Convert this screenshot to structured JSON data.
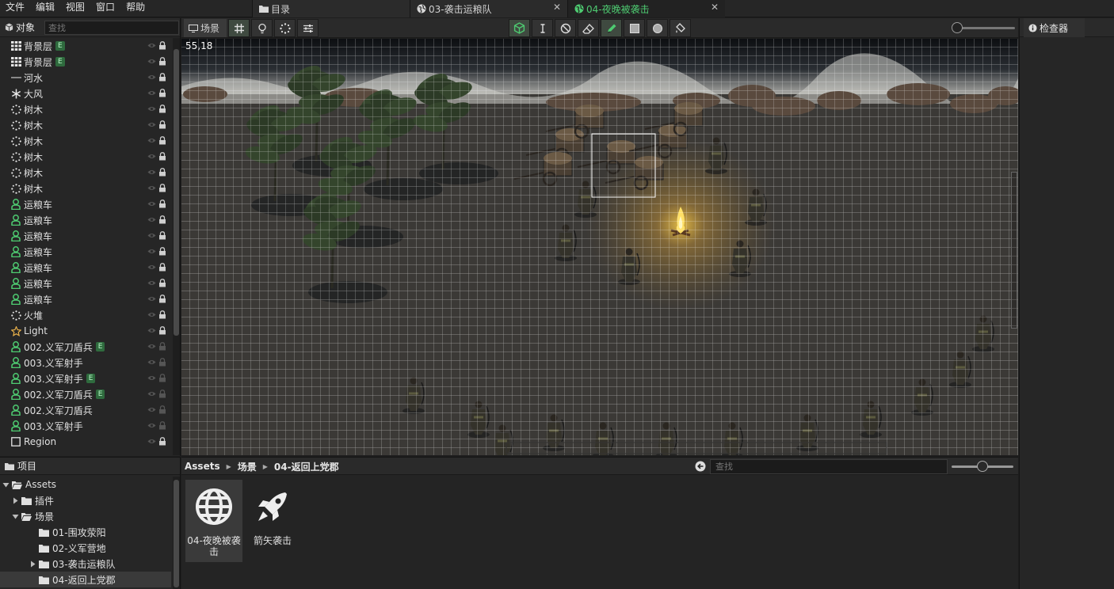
{
  "menu": [
    "文件",
    "编辑",
    "视图",
    "窗口",
    "帮助"
  ],
  "doc_tabs": [
    {
      "label": "目录",
      "icon": "folder-icon"
    },
    {
      "label": "03-袭击运粮队",
      "icon": "globe-icon",
      "close": "✕"
    },
    {
      "label": "04-夜晚被袭击",
      "icon": "globe-icon",
      "close": "✕",
      "active": true
    }
  ],
  "hierarchy": {
    "title": "对象",
    "search_placeholder": "查找",
    "items": [
      {
        "label": "背景层",
        "icon": "grid-icon",
        "badge": "E"
      },
      {
        "label": "背景层",
        "icon": "grid-icon",
        "badge": "E"
      },
      {
        "label": "河水",
        "icon": "line-icon"
      },
      {
        "label": "大风",
        "icon": "snowflake-icon"
      },
      {
        "label": "树木",
        "icon": "particle-icon"
      },
      {
        "label": "树木",
        "icon": "particle-icon"
      },
      {
        "label": "树木",
        "icon": "particle-icon"
      },
      {
        "label": "树木",
        "icon": "particle-icon"
      },
      {
        "label": "树木",
        "icon": "particle-icon"
      },
      {
        "label": "树木",
        "icon": "particle-icon"
      },
      {
        "label": "运粮车",
        "icon": "person-icon"
      },
      {
        "label": "运粮车",
        "icon": "person-icon"
      },
      {
        "label": "运粮车",
        "icon": "person-icon"
      },
      {
        "label": "运粮车",
        "icon": "person-icon"
      },
      {
        "label": "运粮车",
        "icon": "person-icon"
      },
      {
        "label": "运粮车",
        "icon": "person-icon"
      },
      {
        "label": "运粮车",
        "icon": "person-icon"
      },
      {
        "label": "火堆",
        "icon": "particle-icon"
      },
      {
        "label": "Light",
        "icon": "star-icon"
      },
      {
        "label": "002.义军刀盾兵",
        "icon": "person-icon",
        "badge": "E"
      },
      {
        "label": "003.义军射手",
        "icon": "person-icon"
      },
      {
        "label": "003.义军射手",
        "icon": "person-icon",
        "badge": "E"
      },
      {
        "label": "002.义军刀盾兵",
        "icon": "person-icon",
        "badge": "E"
      },
      {
        "label": "002.义军刀盾兵",
        "icon": "person-icon"
      },
      {
        "label": "003.义军射手",
        "icon": "person-icon"
      },
      {
        "label": "Region",
        "icon": "square-icon"
      }
    ]
  },
  "scene": {
    "tab_label": "场景",
    "coord": "55,18",
    "colors": {
      "grid": "#ffffff",
      "fire": "#ffd24a",
      "ground": "#3a3835",
      "active_tool": "#4ecb71"
    }
  },
  "inspector": {
    "title": "检查器"
  },
  "project": {
    "title": "项目",
    "tree": [
      {
        "label": "Assets",
        "depth": 0,
        "expanded": true
      },
      {
        "label": "插件",
        "depth": 1,
        "expanded": false
      },
      {
        "label": "场景",
        "depth": 1,
        "expanded": true
      },
      {
        "label": "01-围攻荥阳",
        "depth": 2
      },
      {
        "label": "02-义军营地",
        "depth": 2
      },
      {
        "label": "03-袭击运粮队",
        "depth": 2,
        "expanded": false
      },
      {
        "label": "04-返回上党郡",
        "depth": 2,
        "selected": true
      }
    ]
  },
  "assets": {
    "breadcrumb": [
      "Assets",
      "场景",
      "04-返回上党郡"
    ],
    "search_placeholder": "查找",
    "items": [
      {
        "label": "04-夜晚被袭击",
        "icon": "globe-icon",
        "selected": true
      },
      {
        "label": "箭矢袭击",
        "icon": "rocket-icon"
      }
    ]
  }
}
